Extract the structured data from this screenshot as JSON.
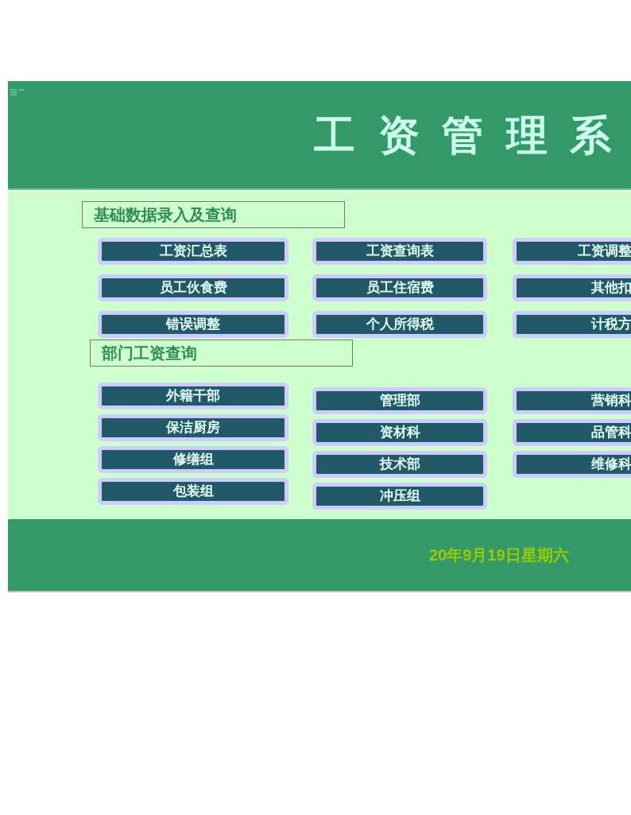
{
  "header": {
    "title": "工资管理系"
  },
  "sections": [
    {
      "title": "基础数据录入及查询",
      "columns": [
        [
          "工资汇总表",
          "员工伙食费",
          "错误调整"
        ],
        [
          "工资查询表",
          "员工住宿费",
          "个人所得税"
        ],
        [
          "工资调整",
          "其他扣",
          "计税方"
        ]
      ]
    },
    {
      "title": "部门工资查询",
      "columns": [
        [
          "外籍干部",
          "保洁厨房",
          "修缮组",
          "包装组"
        ],
        [
          "管理部",
          "资材科",
          "技术部",
          "冲压组"
        ],
        [
          "营销科",
          "品管科",
          "维修科"
        ]
      ]
    }
  ],
  "footer": {
    "date": "20年9月19日星期六"
  }
}
